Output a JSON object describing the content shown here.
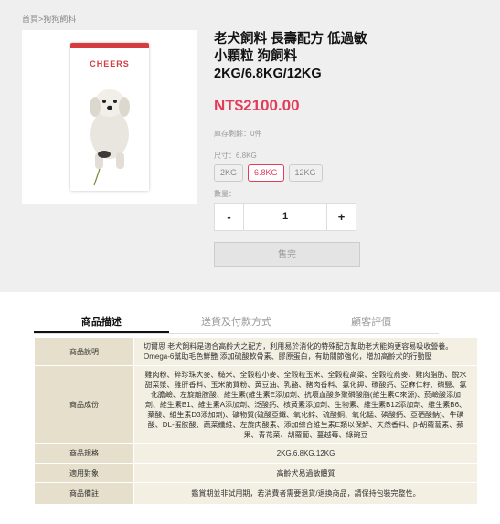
{
  "breadcrumb": {
    "home": "首頁",
    "separator": ">",
    "category": "狗狗飼料"
  },
  "product_image": {
    "brand": "CHEERS"
  },
  "product": {
    "title": "老犬飼料 長壽配方 低過敏 小顆粒 狗飼料 2KG/6.8KG/12KG",
    "price": "NT$2100.00",
    "stock": "庫存剩餘：0件",
    "size_label": "尺寸：6.8KG",
    "sizes": [
      {
        "label": "2KG",
        "selected": false
      },
      {
        "label": "6.8KG",
        "selected": true
      },
      {
        "label": "12KG",
        "selected": false
      }
    ],
    "qty_label": "數量：",
    "qty": {
      "minus": "-",
      "value": "1",
      "plus": "+"
    },
    "sold_out": "售完"
  },
  "tabs": [
    {
      "label": "商品描述",
      "active": true
    },
    {
      "label": "送貨及付款方式",
      "active": false
    },
    {
      "label": "顧客評價",
      "active": false
    }
  ],
  "specs": [
    {
      "key": "商品說明",
      "value": "切爾思 老犬飼料是適合高齡犬之配方，利用易於消化的特殊配方幫助老犬能夠更容易吸收營養。 Omega-6幫助毛色鮮艷 添加硫酸軟骨素、膠原蛋白，有助關節強化，增加高齡犬的行動壓"
    },
    {
      "key": "商品成份",
      "value": "雞肉粉、碎珍珠大麥、糙米、全穀粒小麥、全穀粒玉米、全穀粒高粱、全穀粒燕麥、雞肉脂肪、脫水甜菜漿、雞肝香料、玉米筋質粉、黃豆油、乳酪、豬肉香料、氯化鉀、碳酸鈣、亞麻仁籽、磷鹽、氯化膽鹼、左旋離胺酸、維生素(維生素E添加劑、抗壞血酸多聚磷酸脂(維生素C來源)、菸鹼酸添加劑、維生素B1、維生素A添加劑、泛酸鈣、核黃素添加劑、生物素、維生素B12添加劑、維生素B6、葉酸、維生素D3添加劑)、礦物質(硫酸亞鐵、氧化鋅、硫酸銅、氧化錳、碘酸鈣、亞硒酸鈉)、牛磺酸、DL-蛋胺酸、蔬菜纖維、左旋肉酸素、添加綜合維生素E類以保鮮、天然香料、β-胡蘿蔔素、蘋果、青花菜、胡蘿蔔、蔓越莓、綠碗豆"
    },
    {
      "key": "商品規格",
      "value": "2KG,6.8KG,12KG"
    },
    {
      "key": "適用對象",
      "value": "高齡犬易過敏體質"
    },
    {
      "key": "商品備註",
      "value": "鑑賞期並非試用期，若消費者需要退貨/退換商品，請保持包裝完整性。"
    }
  ],
  "colors": {
    "accent": "#e23c5a",
    "brand_red": "#d63b3f",
    "spec_key_bg": "#e6dfcb",
    "spec_val_bg": "#f3efe2"
  }
}
